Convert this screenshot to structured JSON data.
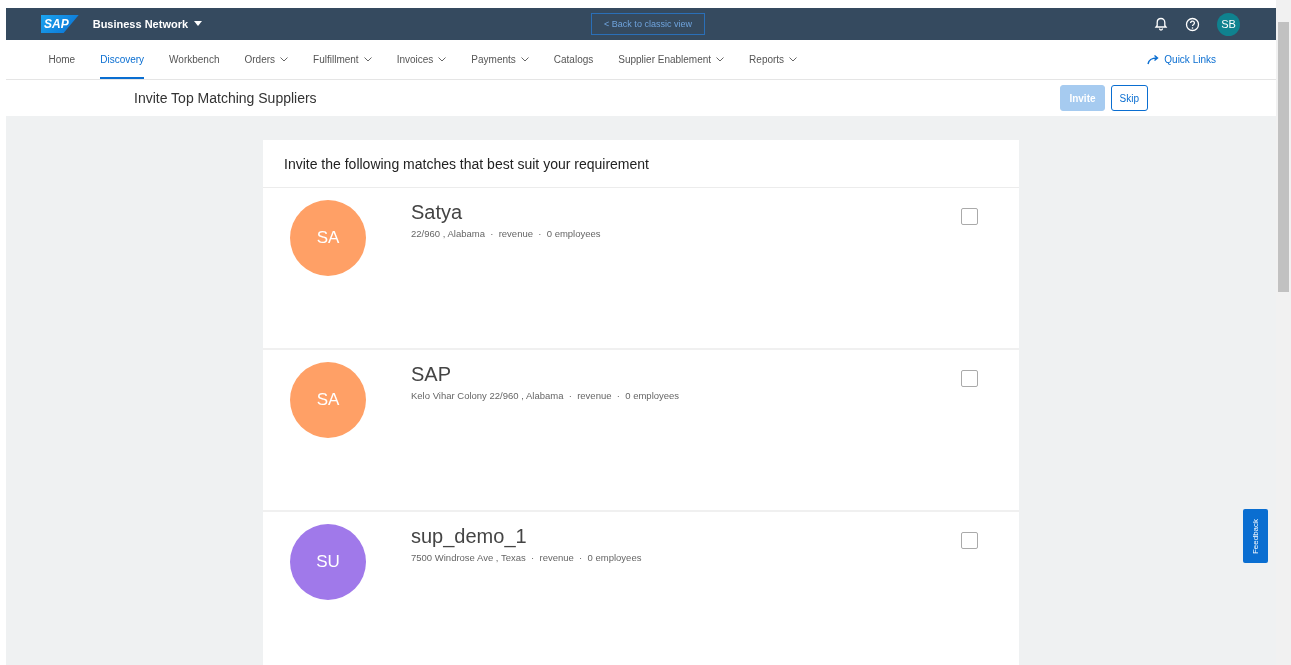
{
  "header": {
    "logo": "SAP",
    "product": "Business Network",
    "classic_view": "< Back to classic view",
    "avatar": "SB"
  },
  "nav": {
    "items": [
      {
        "label": "Home",
        "selected": false,
        "dropdown": false
      },
      {
        "label": "Discovery",
        "selected": true,
        "dropdown": false
      },
      {
        "label": "Workbench",
        "selected": false,
        "dropdown": false
      },
      {
        "label": "Orders",
        "selected": false,
        "dropdown": true
      },
      {
        "label": "Fulfillment",
        "selected": false,
        "dropdown": true
      },
      {
        "label": "Invoices",
        "selected": false,
        "dropdown": true
      },
      {
        "label": "Payments",
        "selected": false,
        "dropdown": true
      },
      {
        "label": "Catalogs",
        "selected": false,
        "dropdown": false
      },
      {
        "label": "Supplier Enablement",
        "selected": false,
        "dropdown": true
      },
      {
        "label": "Reports",
        "selected": false,
        "dropdown": true
      }
    ],
    "quick_links": "Quick Links"
  },
  "page": {
    "title": "Invite Top Matching Suppliers",
    "invite_button": {
      "label": "Invite",
      "disabled": true
    },
    "skip_button": "Skip"
  },
  "card": {
    "heading": "Invite the following matches that best suit your requirement",
    "suppliers": [
      {
        "initials": "SA",
        "name": "Satya",
        "details": "22/960 , Alabama  ·  revenue  ·  0 employees",
        "color": "#ffa066",
        "checked": false
      },
      {
        "initials": "SA",
        "name": "SAP",
        "details": "Kelo Vihar Colony 22/960 , Alabama  ·  revenue  ·  0 employees",
        "color": "#ffa066",
        "checked": false
      },
      {
        "initials": "SU",
        "name": "sup_demo_1",
        "details": "7500 Windrose Ave , Texas  ·  revenue  ·  0 employees",
        "color": "#a079ea",
        "checked": false
      }
    ]
  },
  "feedback": "Feedback"
}
